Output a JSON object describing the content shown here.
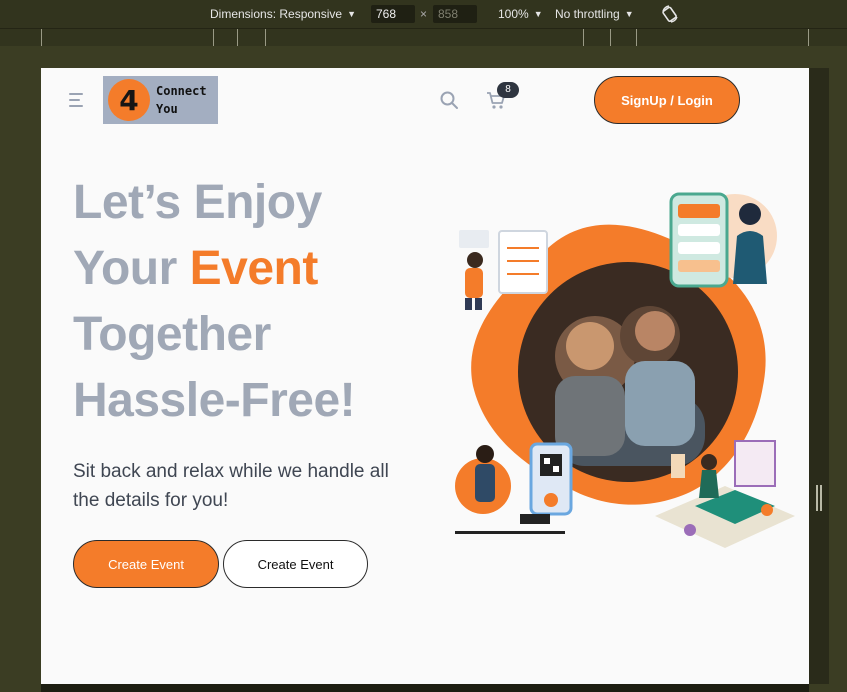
{
  "devtools": {
    "dimensions_label": "Dimensions: Responsive",
    "width_value": "768",
    "height_placeholder": "858",
    "times_symbol": "×",
    "zoom": "100%",
    "throttling": "No throttling"
  },
  "navbar": {
    "logo_letter": "4",
    "logo_line1": "Connect",
    "logo_line2": "You",
    "cart_count": "8",
    "signup_label": "SignUp / Login"
  },
  "hero": {
    "title_line1": "Let’s Enjoy",
    "title_line2_prefix": "Your ",
    "title_line2_accent": "Event",
    "title_line3": "Together",
    "title_line4": "Hassle-Free!",
    "subtitle": "Sit back and relax while we handle all the details for you!",
    "primary_button": "Create Event",
    "secondary_button": "Create Event"
  },
  "colors": {
    "accent": "#f47c2a",
    "title_gray": "#a0a8b6",
    "page_bg": "#fafafa"
  }
}
